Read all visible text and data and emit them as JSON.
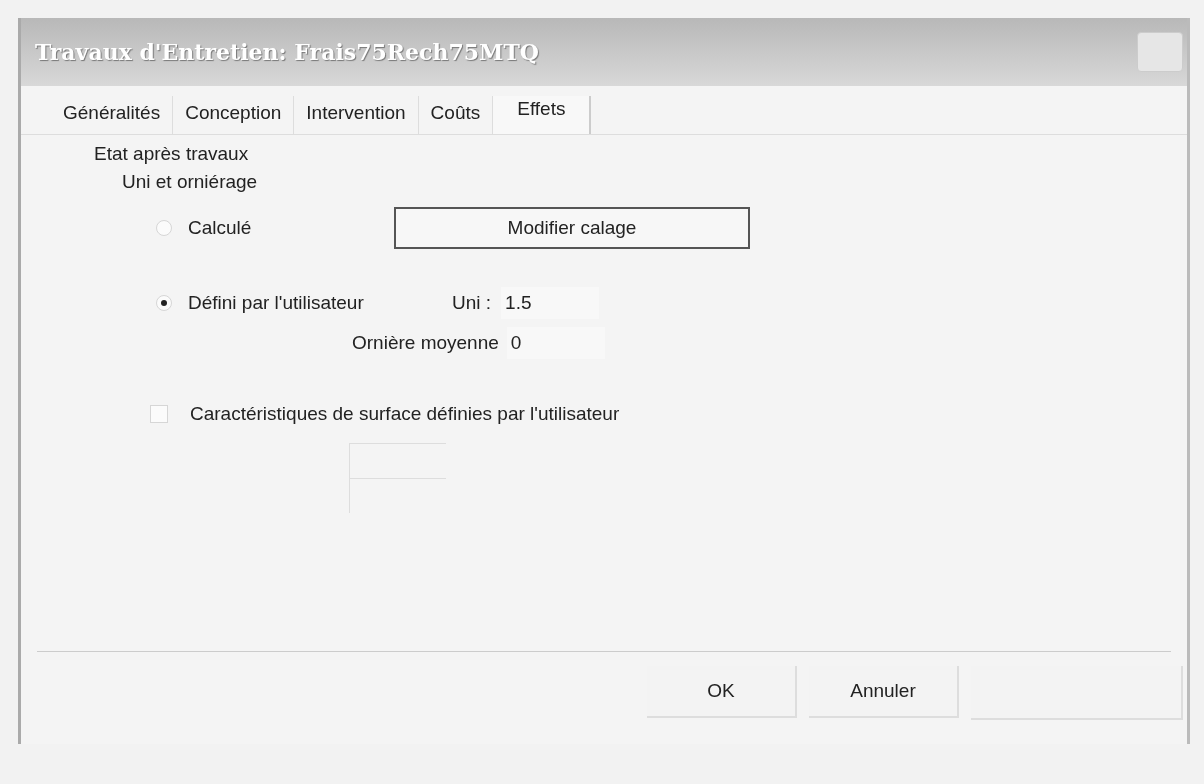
{
  "window": {
    "title": "Travaux d'Entretien: Frais75Rech75MTQ"
  },
  "tabs": [
    {
      "label": "Généralités",
      "selected": false
    },
    {
      "label": "Conception",
      "selected": false
    },
    {
      "label": "Intervention",
      "selected": false
    },
    {
      "label": "Coûts",
      "selected": false
    },
    {
      "label": "Effets",
      "selected": true
    }
  ],
  "section": {
    "title": "Etat après travaux",
    "subtitle": "Uni et orniérage"
  },
  "options": [
    {
      "label": "Calculé",
      "selected": false
    },
    {
      "label": "Défini par l'utilisateur",
      "selected": true
    }
  ],
  "calibrate_button": "Modifier calage",
  "fields": [
    {
      "label": "Uni :",
      "value": "1.5"
    },
    {
      "label": "Ornière moyenne",
      "value": "0"
    }
  ],
  "surface_checkbox": {
    "label": "Caractéristiques de surface définies par l'utilisateur",
    "checked": false
  },
  "buttons": [
    "OK",
    "Annuler"
  ]
}
